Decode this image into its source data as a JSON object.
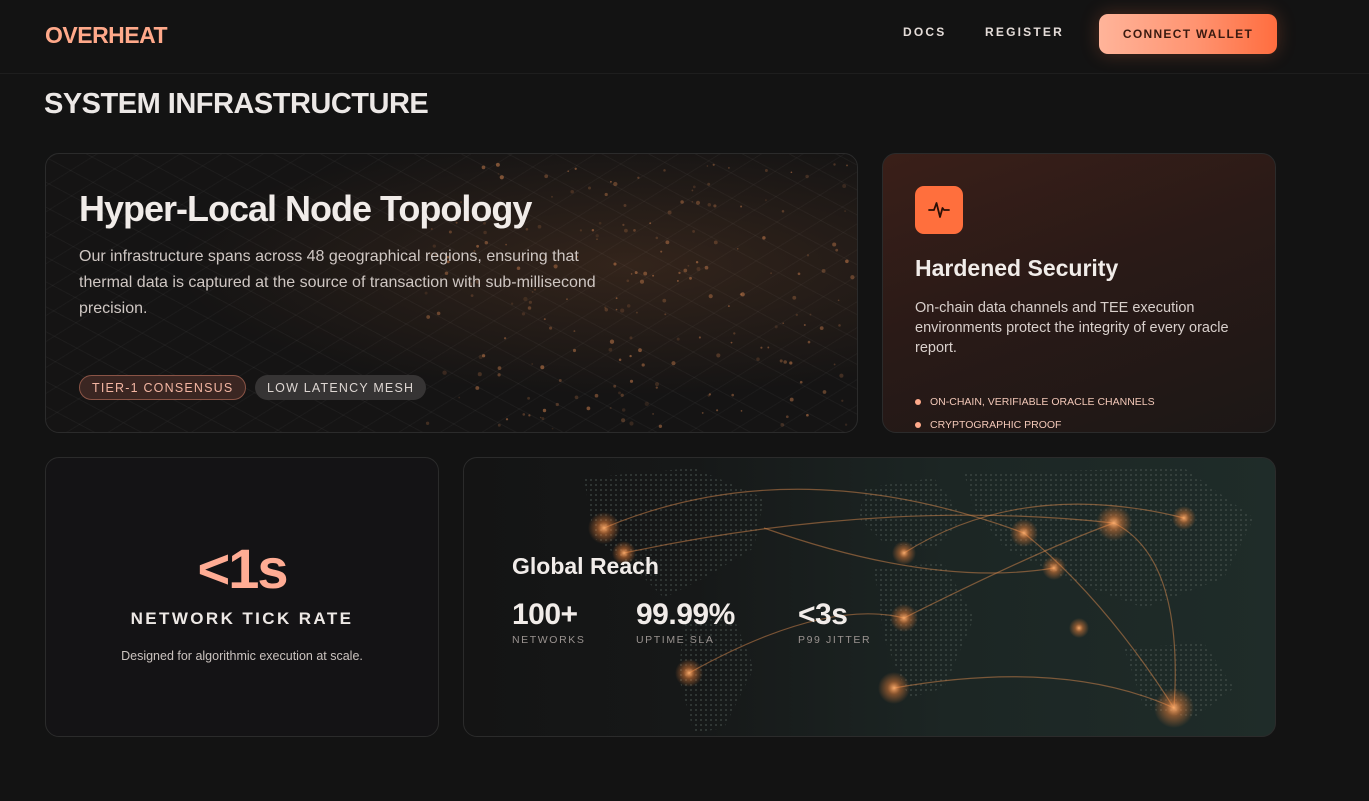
{
  "brand": "OVERHEAT",
  "nav": {
    "docs": "DOCS",
    "register": "REGISTER",
    "connect_wallet": "CONNECT WALLET"
  },
  "section_title": "SYSTEM INFRASTRUCTURE",
  "topology": {
    "title": "Hyper-Local Node Topology",
    "description": "Our infrastructure spans across 48 geographical regions, ensuring that thermal data is captured at the source of transaction with sub-millisecond precision.",
    "tags": [
      "TIER-1 CONSENSUS",
      "LOW LATENCY MESH"
    ]
  },
  "security": {
    "icon": "activity-pulse-icon",
    "title": "Hardened Security",
    "description": "On-chain data channels and TEE execution environments protect the integrity of every oracle report.",
    "features": [
      "ON-CHAIN, VERIFIABLE ORACLE CHANNELS",
      "CRYPTOGRAPHIC PROOF"
    ]
  },
  "tick_rate": {
    "value": "<1s",
    "label": "NETWORK TICK RATE",
    "description": "Designed for algorithmic execution at scale."
  },
  "global_reach": {
    "title": "Global Reach",
    "stats": [
      {
        "value": "100+",
        "label": "NETWORKS"
      },
      {
        "value": "99.99%",
        "label": "UPTIME SLA"
      },
      {
        "value": "<3s",
        "label": "P99 JITTER"
      }
    ]
  },
  "colors": {
    "accent": "#ff6f3d",
    "accent_light": "#ffa98a",
    "background": "#131313"
  }
}
